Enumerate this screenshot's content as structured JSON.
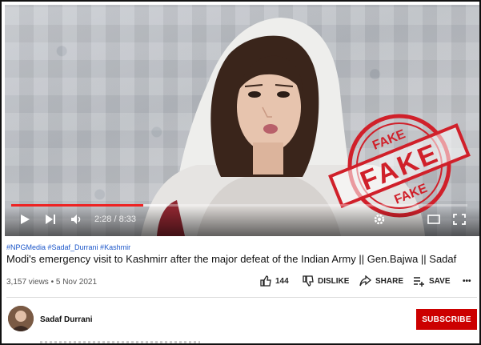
{
  "player": {
    "time_current": "2:28",
    "time_total": "8:33",
    "time_display": "2:28 / 8:33",
    "progress_played": 0.29,
    "progress_loaded": 0.34,
    "icons": [
      "play-icon",
      "next-icon",
      "volume-icon",
      "autoplay-toggle-icon",
      "gear-icon",
      "miniplayer-icon",
      "theater-icon",
      "fullscreen-icon"
    ]
  },
  "stamp": {
    "text_top": "FAKE",
    "text_center": "FAKE",
    "text_bottom": "FAKE",
    "color": "#d0202a"
  },
  "video": {
    "hashtags": "#NPGMedia #Sadaf_Durrani #Kashmir",
    "title": "Modi's emergency visit to Kashmirr after the major defeat of the Indian Army || Gen.Bajwa || Sadaf",
    "views_date": "3,157 views • 5 Nov 2021"
  },
  "actions": {
    "likes": "144",
    "dislike": "DISLIKE",
    "share": "SHARE",
    "save": "SAVE",
    "more": "•••"
  },
  "channel": {
    "name": "Sadaf Durrani",
    "subscribe": "SUBSCRIBE"
  },
  "colors": {
    "accent_red": "#cc0000",
    "hashtag_blue": "#1a55c9",
    "progress_red": "#ee2222"
  }
}
